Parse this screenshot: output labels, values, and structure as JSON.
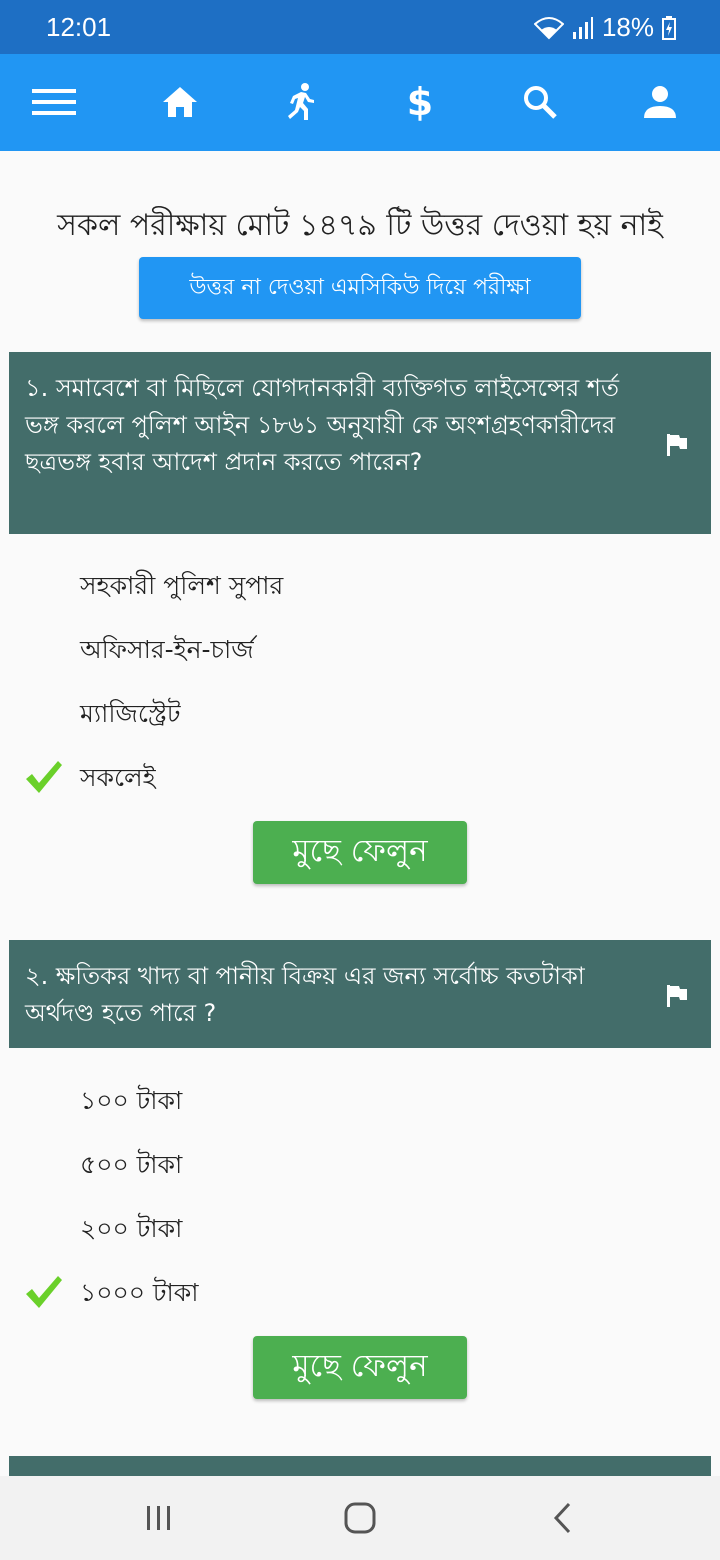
{
  "status": {
    "time": "12:01",
    "battery": "18%"
  },
  "toolbar": {
    "icons": [
      "menu-icon",
      "home-icon",
      "running-person-icon",
      "dollar-icon",
      "search-icon",
      "person-icon"
    ],
    "dollar_glyph": "$"
  },
  "summary_text": "সকল পরীক্ষায় মোট ১৪৭৯ টি উত্তর দেওয়া হয় নাই",
  "exam_button_label": "উত্তর না দেওয়া এমসিকিউ দিয়ে পরীক্ষা",
  "questions": [
    {
      "text": "১. সমাবেশে বা মিছিলে যোগদানকারী ব্যক্তিগত লাইসেন্সের শর্ত ভঙ্গ করলে পুলিশ আইন ১৮৬১ অনুযায়ী কে অংশগ্রহণকারীদের ছত্রভঙ্গ হবার আদেশ প্রদান করতে পারেন?",
      "options": [
        "সহকারী পুলিশ সুপার",
        "অফিসার-ইন-চার্জ",
        "ম্যাজিস্ট্রেট",
        "সকলেই"
      ],
      "correct_index": 3,
      "erase_label": "মুছে ফেলুন"
    },
    {
      "text": "২. ক্ষতিকর খাদ্য বা পানীয় বিক্রয় এর জন্য সর্বোচ্চ কতটাকা অর্থদণ্ড হতে পারে ?",
      "options": [
        "১০০ টাকা",
        "৫০০ টাকা",
        "২০০ টাকা",
        "১০০০ টাকা"
      ],
      "correct_index": 3,
      "erase_label": "মুছে ফেলুন"
    }
  ],
  "colors": {
    "status_bar": "#1e6fc4",
    "toolbar": "#2196f3",
    "question_header": "#436d6a",
    "erase_button": "#4caf50",
    "check": "#6ad02a"
  }
}
